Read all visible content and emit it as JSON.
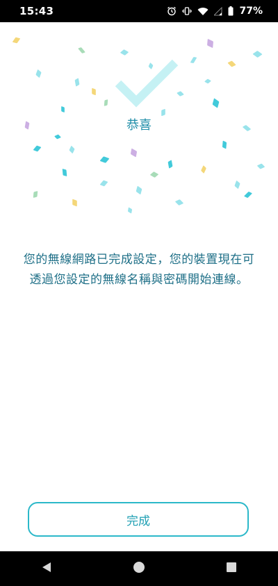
{
  "status_bar": {
    "time": "15:43",
    "battery": "77%",
    "icons": [
      "alarm-icon",
      "vibrate-icon",
      "wifi-icon",
      "signal-icon",
      "battery-icon"
    ]
  },
  "celebration": {
    "title": "恭喜",
    "icon": "checkmark-icon",
    "accent_color": "#2bb8c9",
    "confetti_colors": [
      "#7fdce6",
      "#2ec4d6",
      "#f3d36a",
      "#c7a6e0",
      "#9fd8b0"
    ]
  },
  "message": {
    "line1": "您的無線網路已完成設定，您的裝置現在可",
    "line2": "透過您設定的無線名稱與密碼開始連線。"
  },
  "footer": {
    "done_label": "完成"
  },
  "navigation": {
    "back": "back-icon",
    "home": "home-icon",
    "recents": "recents-icon"
  }
}
